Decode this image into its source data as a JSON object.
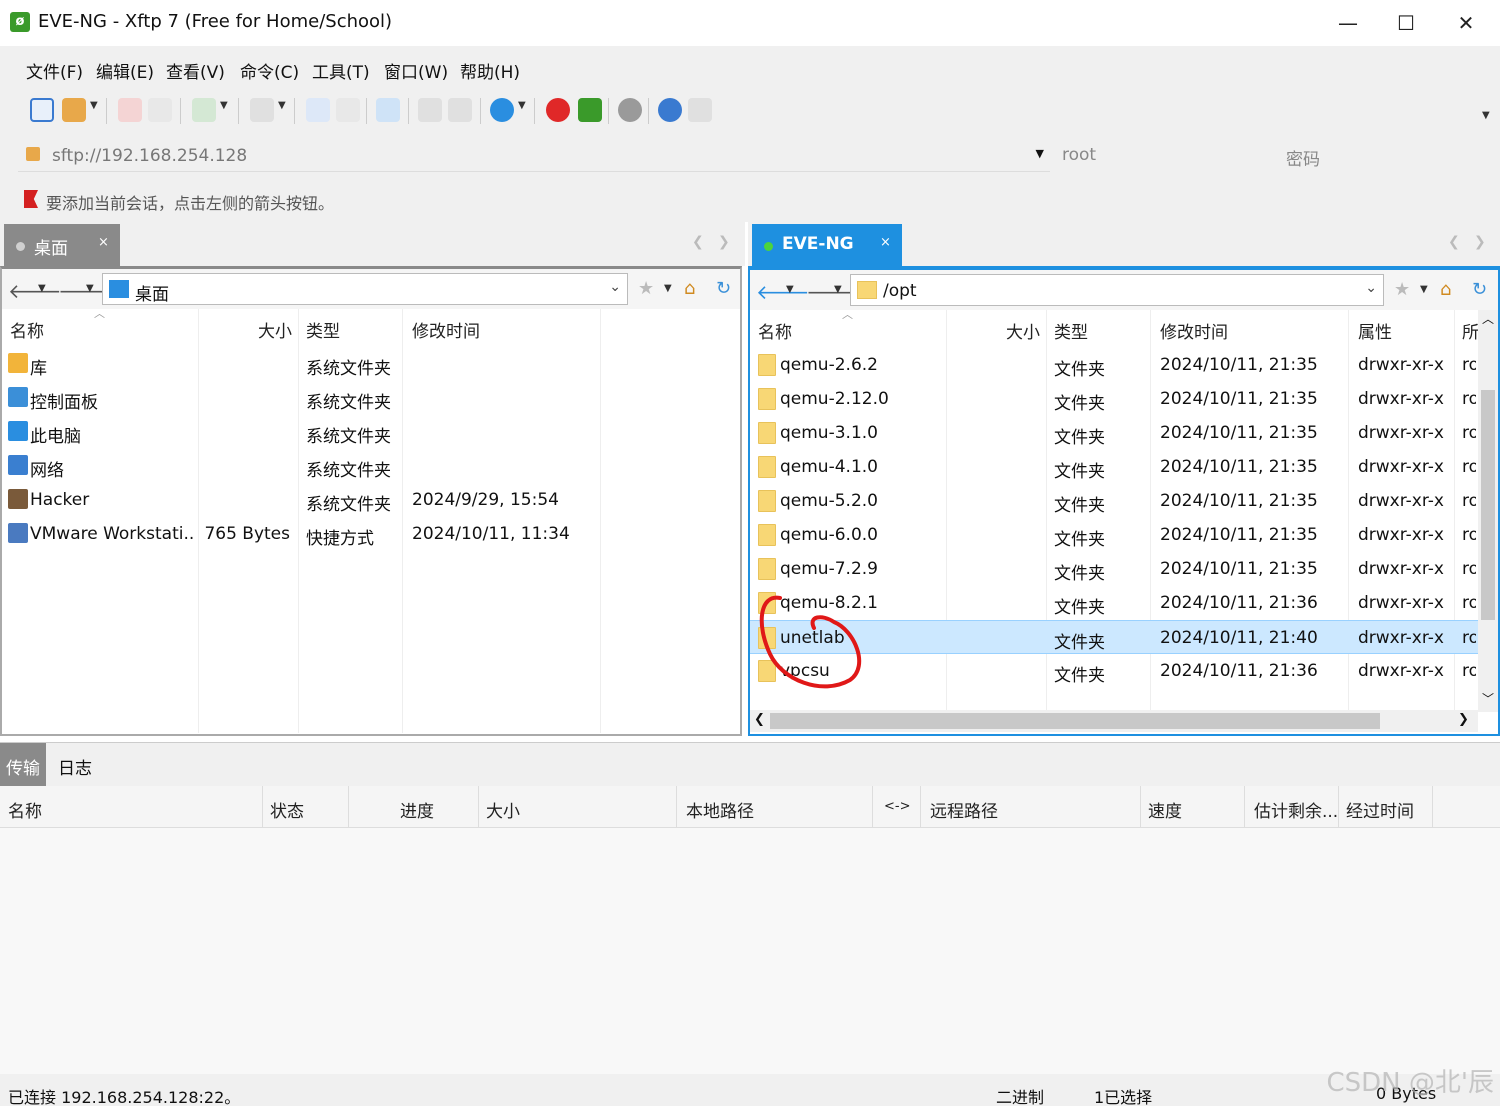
{
  "window": {
    "title": "EVE-NG - Xftp 7 (Free for Home/School)",
    "app_icon": "xftp-logo-icon",
    "minimize": "—",
    "maximize": "☐",
    "close": "✕"
  },
  "menu": [
    "文件(F)",
    "编辑(E)",
    "查看(V)",
    "命令(C)",
    "工具(T)",
    "窗口(W)",
    "帮助(H)"
  ],
  "address": {
    "value": "sftp://192.168.254.128",
    "user_value": "root",
    "password_placeholder": "密码"
  },
  "hint": "要添加当前会话，点击左侧的箭头按钮。",
  "left_tab": {
    "label": "桌面",
    "close": "×"
  },
  "right_tab": {
    "label": "EVE-NG",
    "close": "×"
  },
  "left_pane": {
    "path": "桌面",
    "columns": [
      "名称",
      "大小",
      "类型",
      "修改时间"
    ],
    "rows": [
      {
        "name": "库",
        "size": "",
        "type": "系统文件夹",
        "modified": "",
        "icon": "library-icon",
        "color": "#f2b43a"
      },
      {
        "name": "控制面板",
        "size": "",
        "type": "系统文件夹",
        "modified": "",
        "icon": "control-panel-icon",
        "color": "#3b8fd8"
      },
      {
        "name": "此电脑",
        "size": "",
        "type": "系统文件夹",
        "modified": "",
        "icon": "computer-icon",
        "color": "#2a8ee0"
      },
      {
        "name": "网络",
        "size": "",
        "type": "系统文件夹",
        "modified": "",
        "icon": "network-icon",
        "color": "#3a7fd0"
      },
      {
        "name": "Hacker",
        "size": "",
        "type": "系统文件夹",
        "modified": "2024/9/29, 15:54",
        "icon": "user-icon",
        "color": "#7a5a3a"
      },
      {
        "name": "VMware Workstati...",
        "size": "765 Bytes",
        "type": "快捷方式",
        "modified": "2024/10/11, 11:34",
        "icon": "vmware-icon",
        "color": "#4a7ac0"
      }
    ]
  },
  "right_pane": {
    "path": "/opt",
    "columns": [
      "名称",
      "大小",
      "类型",
      "修改时间",
      "属性",
      "所"
    ],
    "rows": [
      {
        "name": "qemu-2.6.2",
        "size": "",
        "type": "文件夹",
        "modified": "2024/10/11, 21:35",
        "attr": "drwxr-xr-x",
        "owner": "ro"
      },
      {
        "name": "qemu-2.12.0",
        "size": "",
        "type": "文件夹",
        "modified": "2024/10/11, 21:35",
        "attr": "drwxr-xr-x",
        "owner": "ro"
      },
      {
        "name": "qemu-3.1.0",
        "size": "",
        "type": "文件夹",
        "modified": "2024/10/11, 21:35",
        "attr": "drwxr-xr-x",
        "owner": "ro"
      },
      {
        "name": "qemu-4.1.0",
        "size": "",
        "type": "文件夹",
        "modified": "2024/10/11, 21:35",
        "attr": "drwxr-xr-x",
        "owner": "ro"
      },
      {
        "name": "qemu-5.2.0",
        "size": "",
        "type": "文件夹",
        "modified": "2024/10/11, 21:35",
        "attr": "drwxr-xr-x",
        "owner": "ro"
      },
      {
        "name": "qemu-6.0.0",
        "size": "",
        "type": "文件夹",
        "modified": "2024/10/11, 21:35",
        "attr": "drwxr-xr-x",
        "owner": "ro"
      },
      {
        "name": "qemu-7.2.9",
        "size": "",
        "type": "文件夹",
        "modified": "2024/10/11, 21:35",
        "attr": "drwxr-xr-x",
        "owner": "ro"
      },
      {
        "name": "qemu-8.2.1",
        "size": "",
        "type": "文件夹",
        "modified": "2024/10/11, 21:36",
        "attr": "drwxr-xr-x",
        "owner": "ro"
      },
      {
        "name": "unetlab",
        "size": "",
        "type": "文件夹",
        "modified": "2024/10/11, 21:40",
        "attr": "drwxr-xr-x",
        "owner": "ro",
        "selected": true
      },
      {
        "name": "vpcsu",
        "size": "",
        "type": "文件夹",
        "modified": "2024/10/11, 21:36",
        "attr": "drwxr-xr-x",
        "owner": "ro"
      }
    ]
  },
  "bottom_tabs": [
    "传输",
    "日志"
  ],
  "transfer_columns": [
    "名称",
    "状态",
    "进度",
    "大小",
    "本地路径",
    "<->",
    "远程路径",
    "速度",
    "估计剩余...",
    "经过时间"
  ],
  "status": {
    "connection": "已连接 192.168.254.128:22。",
    "mode": "二进制",
    "selection": "1已选择",
    "size": "0 Bytes"
  },
  "watermark": "CSDN @北'辰",
  "colors": {
    "accent": "#1e90e0",
    "selection": "#cce8ff",
    "folder": "#f8d775",
    "annotation": "#e01818"
  }
}
